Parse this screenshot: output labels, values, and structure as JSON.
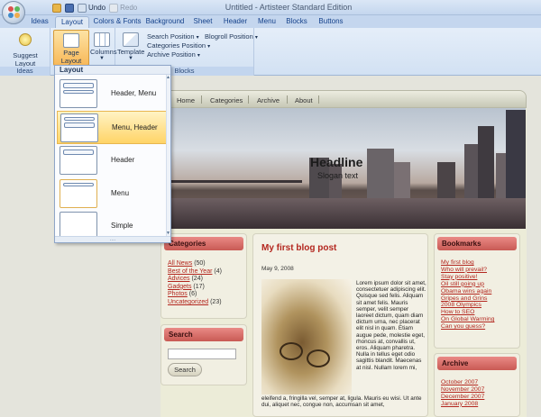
{
  "window": {
    "title": "Untitled - Artisteer Standard Edition",
    "qat": {
      "undo": "Undo",
      "redo": "Redo"
    }
  },
  "tabs": [
    "Ideas",
    "Layout",
    "Colors & Fonts",
    "Background",
    "Sheet",
    "Header",
    "Menu",
    "Blocks",
    "Buttons"
  ],
  "active_tab": "Layout",
  "ribbon": {
    "ideas_group": {
      "label": "Ideas",
      "suggest": "Suggest Layout"
    },
    "page_group": {
      "page_layout": "Page Layout",
      "columns": "Columns"
    },
    "blocks_group": {
      "label": "Blocks",
      "template": "Template",
      "search_position": "Search Position",
      "categories_position": "Categories Position",
      "archive_position": "Archive Position",
      "blogroll_position": "Blogroll Position"
    }
  },
  "dropdown": {
    "header": "Layout",
    "items": [
      "Header, Menu",
      "Menu, Header",
      "Header",
      "Menu",
      "Simple"
    ],
    "selected_index": 1,
    "grip": "...."
  },
  "site": {
    "nav": [
      "Home",
      "Categories",
      "Archive",
      "About"
    ],
    "headline": "Headline",
    "slogan": "Slogan text",
    "categories": {
      "title": "Categories",
      "items": [
        {
          "name": "All News",
          "count": "(50)"
        },
        {
          "name": "Best of the Year",
          "count": "(4)"
        },
        {
          "name": "Advices",
          "count": "(24)"
        },
        {
          "name": "Gadgets",
          "count": "(17)"
        },
        {
          "name": "Photos",
          "count": "(6)"
        },
        {
          "name": "Uncategorized",
          "count": "(23)"
        }
      ]
    },
    "search": {
      "title": "Search",
      "button": "Search"
    },
    "post": {
      "title": "My first blog post",
      "date": "May 9, 2008",
      "text_side": "Lorem ipsum dolor sit amet, consectetuer adipiscing elit. Quisque sed felis. Aliquam sit amet felis. Mauris semper, velit semper laoreet dictum, quam diam dictum urna, nec placerat elit nisl in quam. Etiam augue pede, molestie eget, rhoncus at, convallis ut, eros. Aliquam pharetra. Nulla in tellus eget odio sagittis blandit. Maecenas at nisl. Nullam lorem mi,",
      "text_full": "eleifend a, fringilla vel, semper at, ligula. Mauris eu wisi. Ut ante dui, aliquet nec, congue non, accumsan sit amet,"
    },
    "bookmarks": {
      "title": "Bookmarks",
      "items": [
        "My first blog",
        "Who will prevail?",
        "Stay positive!",
        "Oil still going up",
        "Obama wins again",
        "Gripes and Grins",
        "2008 Olympics",
        "How to SEO",
        "On Global Warming",
        "Can you guess?"
      ]
    },
    "archive": {
      "title": "Archive",
      "items": [
        "October 2007",
        "November 2007",
        "December 2007",
        "January 2008"
      ]
    }
  }
}
